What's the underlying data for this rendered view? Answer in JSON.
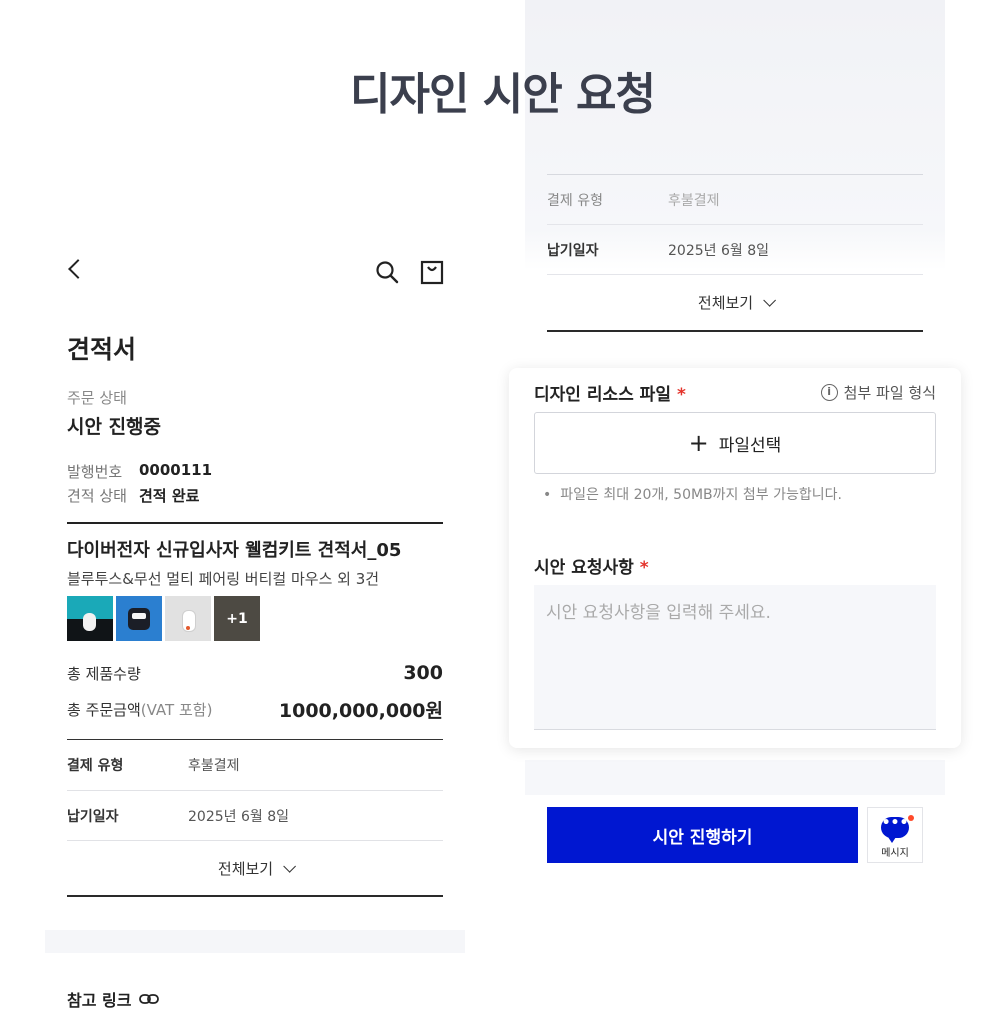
{
  "page_title": "디자인 시안 요청",
  "right_panel": {
    "info_rows": [
      {
        "label": "결제 유형",
        "value": "후불결제"
      },
      {
        "label": "납기일자",
        "value": "2025년 6월 8일"
      }
    ],
    "view_all": "전체보기",
    "resource": {
      "label": "디자인 리소스 파일",
      "required_mark": "*",
      "help": "첨부 파일 형식",
      "file_button": "파일선택",
      "note": "파일은 최대 20개, 50MB까지 첨부 가능합니다."
    },
    "request": {
      "label": "시안 요청사항",
      "required_mark": "*",
      "placeholder": "시안 요청사항을 입력해 주세요."
    },
    "submit_button": "시안 진행하기",
    "message_button": "메시지"
  },
  "left_panel": {
    "title": "견적서",
    "order_status_label": "주문 상태",
    "order_status_value": "시안 진행중",
    "issue_no_label": "발행번호",
    "issue_no_value": "0000111",
    "quote_status_label": "견적 상태",
    "quote_status_value": "견적 완료",
    "product_title": "다이버전자 신규입사자 웰컴키트 견적서_05",
    "product_subtitle": "블루투스&무선 멀티 페어링 버티컬 마우스 외 3건",
    "more_thumbs": "+1",
    "total_qty_label": "총 제품수량",
    "total_qty_value": "300",
    "total_amount_label": "총 주문금액",
    "vat_note": "(VAT 포함)",
    "total_amount_value": "1000,000,000원",
    "info_rows": [
      {
        "label": "결제 유형",
        "value": "후불결제"
      },
      {
        "label": "납기일자",
        "value": "2025년 6월 8일"
      }
    ],
    "view_all": "전체보기",
    "reference_link": "참고 링크"
  }
}
